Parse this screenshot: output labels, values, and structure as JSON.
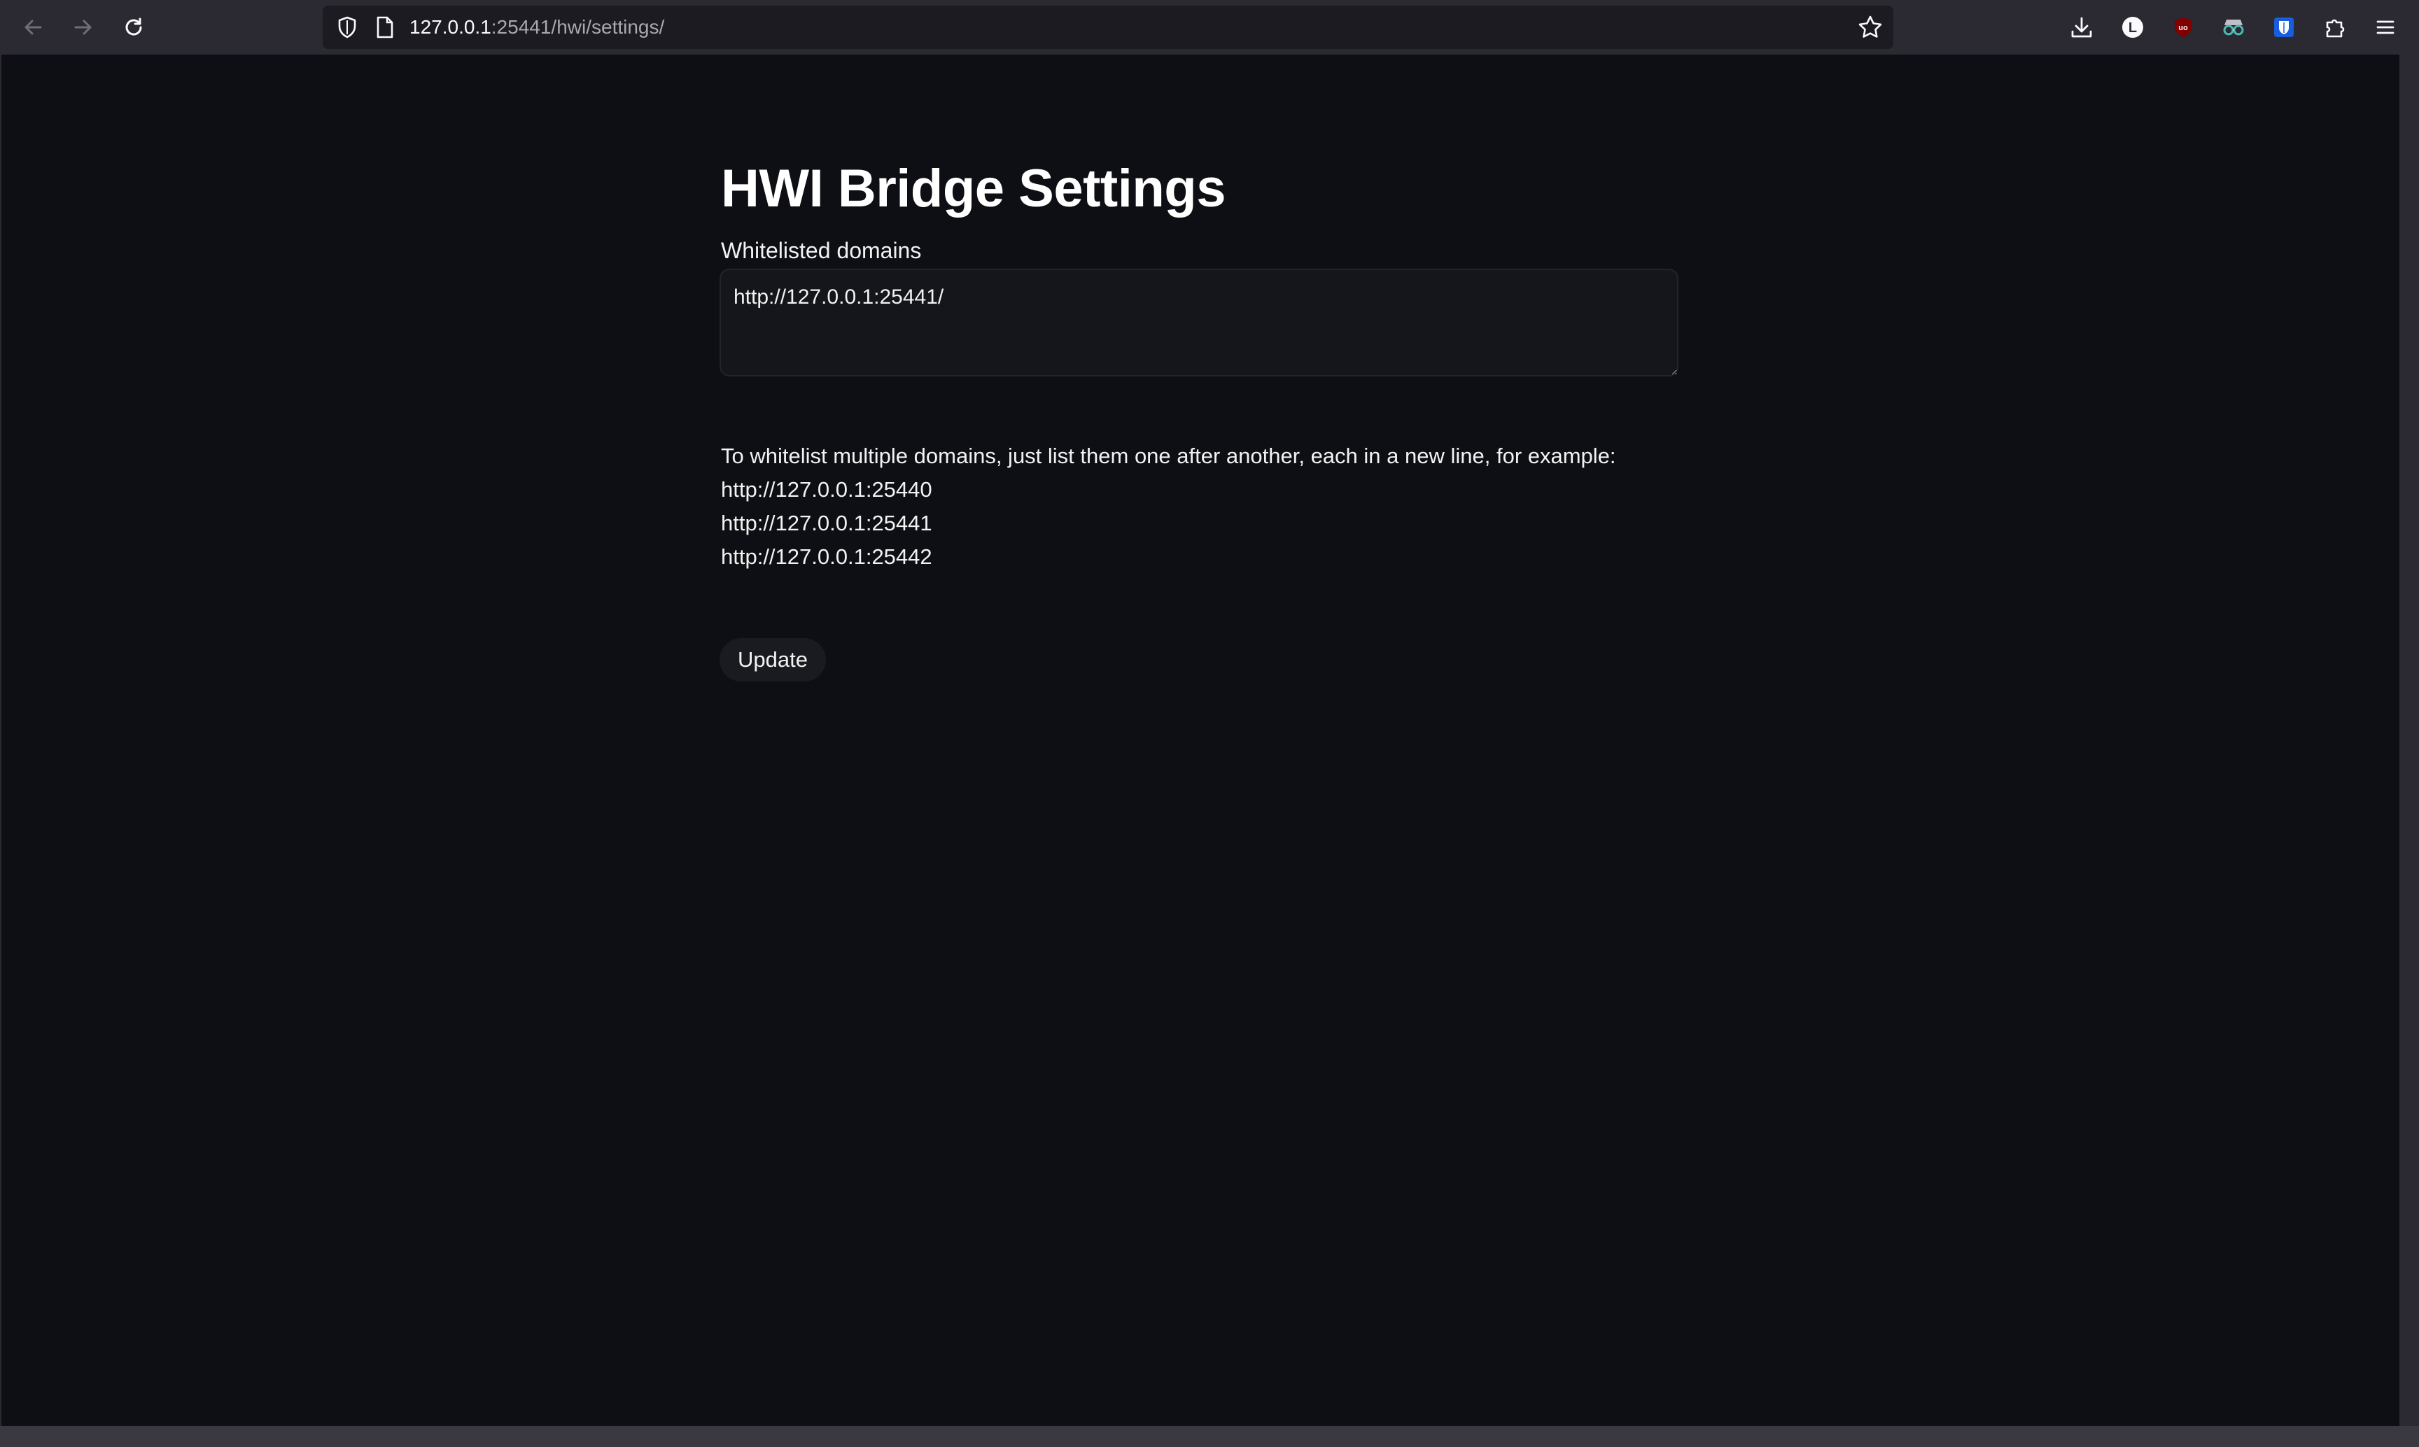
{
  "browser": {
    "url_host": "127.0.0.1",
    "url_rest": ":25441/hwi/settings/",
    "icons": {
      "back": "back-arrow-icon",
      "forward": "forward-arrow-icon",
      "reload": "reload-icon",
      "shield": "tracking-protection-shield-icon",
      "page": "page-info-icon",
      "star": "bookmark-star-icon",
      "downloads": "downloads-icon",
      "ext1": "extension-l-icon",
      "ext2": "ublock-origin-icon",
      "ext3": "incognito-extension-icon",
      "ext4": "bitwarden-icon",
      "extensions": "extensions-puzzle-icon",
      "menu": "hamburger-menu-icon"
    },
    "ext1_letter": "L",
    "ext2_text": "uo"
  },
  "page": {
    "title": "HWI Bridge Settings",
    "whitelist_label": "Whitelisted domains",
    "whitelist_value": "http://127.0.0.1:25441/",
    "help_text": "To whitelist multiple domains, just list them one after another, each in a new line, for example:",
    "examples": [
      "http://127.0.0.1:25440",
      "http://127.0.0.1:25441",
      "http://127.0.0.1:25442"
    ],
    "update_label": "Update"
  },
  "colors": {
    "page_background": "#0e0f14",
    "browser_chrome": "#2b2a33",
    "text": "#f2f2f2",
    "bitwarden_blue": "#175ddc",
    "ublock_red": "#800000"
  }
}
